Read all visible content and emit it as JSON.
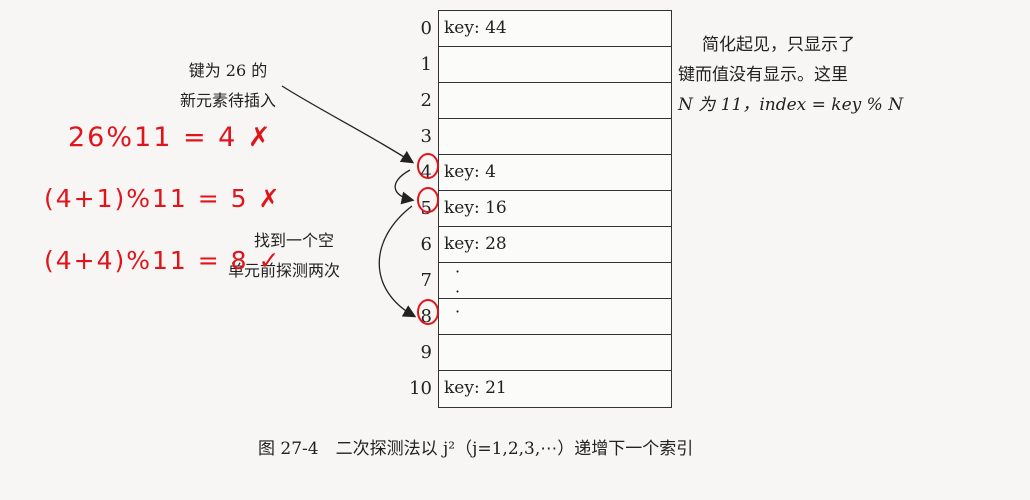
{
  "table": {
    "rows": [
      {
        "index": "0",
        "text": "key: 44"
      },
      {
        "index": "1",
        "text": ""
      },
      {
        "index": "2",
        "text": ""
      },
      {
        "index": "3",
        "text": ""
      },
      {
        "index": "4",
        "text": "key: 4"
      },
      {
        "index": "5",
        "text": "key: 16"
      },
      {
        "index": "6",
        "text": "key: 28"
      },
      {
        "index": "7",
        "text": ""
      },
      {
        "index": "8",
        "text": ""
      },
      {
        "index": "9",
        "text": ""
      },
      {
        "index": "10",
        "text": "key: 21"
      }
    ],
    "dots": "·"
  },
  "left_label": {
    "line1": "键为 26 的",
    "line2": "新元素待插入"
  },
  "probe_label": {
    "line1": "找到一个空",
    "line2": "单元前探测两次"
  },
  "note": {
    "line1": "简化起见，只显示了",
    "line2": "键而值没有显示。这里",
    "line3": "N 为 11，index = key % N"
  },
  "handwriting": {
    "line1": "26%11 = 4 ✗",
    "line2": "(4+1)%11 = 5 ✗",
    "line3": "(4+4)%11 = 8 ✓"
  },
  "caption": "图 27-4　二次探测法以 j²（j=1,2,3,⋯）递增下一个索引",
  "colors": {
    "ink": "#222222",
    "annotation": "#e0141b"
  }
}
